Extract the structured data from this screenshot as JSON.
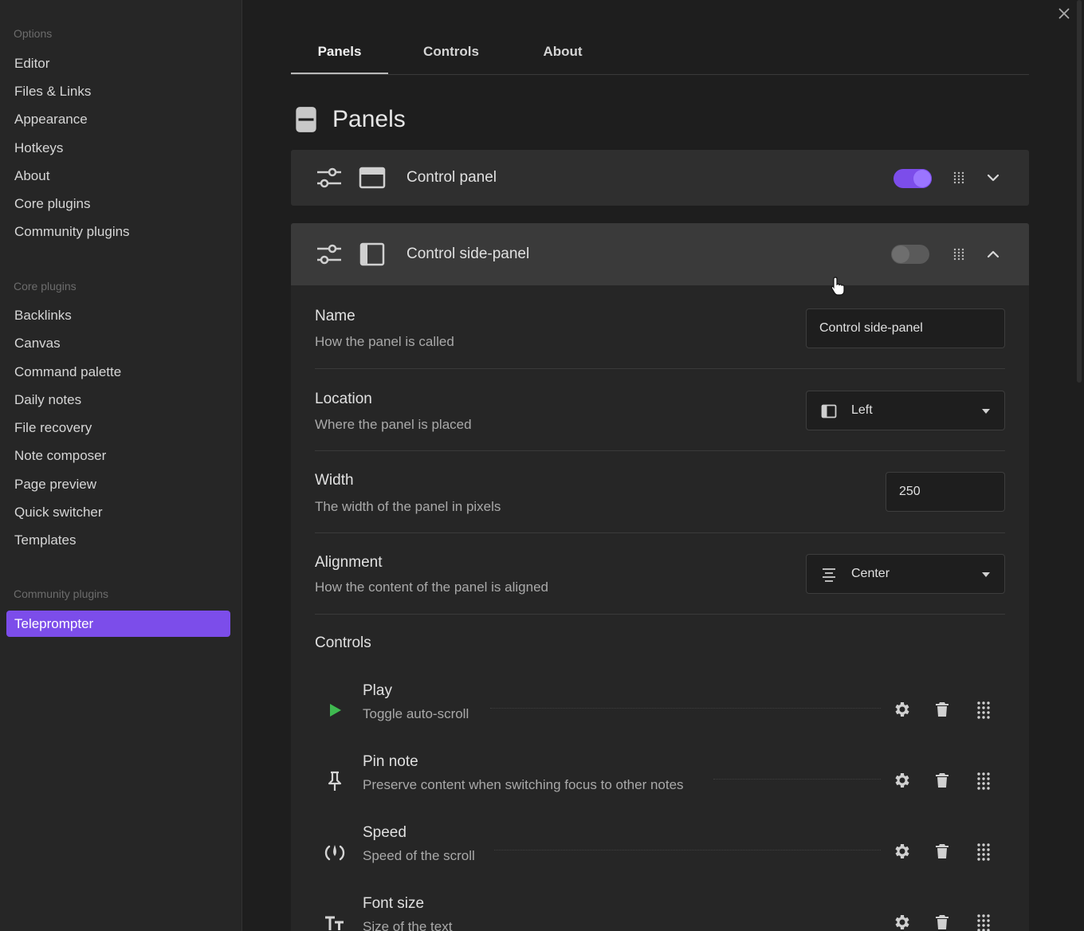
{
  "sidebar": {
    "options_title": "Options",
    "options": [
      "Editor",
      "Files & Links",
      "Appearance",
      "Hotkeys",
      "About",
      "Core plugins",
      "Community plugins"
    ],
    "core_title": "Core plugins",
    "core": [
      "Backlinks",
      "Canvas",
      "Command palette",
      "Daily notes",
      "File recovery",
      "Note composer",
      "Page preview",
      "Quick switcher",
      "Templates"
    ],
    "community_title": "Community plugins",
    "community": [
      "Teleprompter"
    ],
    "active_item": "Teleprompter",
    "accent_color": "#7c4dea"
  },
  "tabs": [
    "Panels",
    "Controls",
    "About"
  ],
  "active_tab": "Panels",
  "section": {
    "title": "Panels",
    "icon": "panel-layout-icon"
  },
  "panels": [
    {
      "label": "Control panel",
      "enabled": true,
      "expanded": false,
      "icons": [
        "sliders-icon",
        "panel-top-icon"
      ]
    },
    {
      "label": "Control side-panel",
      "enabled": false,
      "expanded": true,
      "icons": [
        "sliders-icon",
        "panel-left-icon"
      ]
    }
  ],
  "settings": {
    "name": {
      "label": "Name",
      "desc": "How the panel is called",
      "value": "Control side-panel"
    },
    "location": {
      "label": "Location",
      "desc": "Where the panel is placed",
      "value": "Left",
      "icon": "panel-left-icon"
    },
    "width": {
      "label": "Width",
      "desc": "The width of the panel in pixels",
      "value": "250"
    },
    "alignment": {
      "label": "Alignment",
      "desc": "How the content of the panel is aligned",
      "value": "Center",
      "icon": "align-center-icon"
    }
  },
  "controls_title": "Controls",
  "controls": [
    {
      "name": "Play",
      "desc": "Toggle auto-scroll",
      "icon": "play-icon",
      "icon_color": "#3fb950"
    },
    {
      "name": "Pin note",
      "desc": "Preserve content when switching focus to other notes",
      "icon": "pin-icon"
    },
    {
      "name": "Speed",
      "desc": "Speed of the scroll",
      "icon": "gauge-icon"
    },
    {
      "name": "Font size",
      "desc": "Size of the text",
      "icon": "font-size-icon"
    }
  ]
}
